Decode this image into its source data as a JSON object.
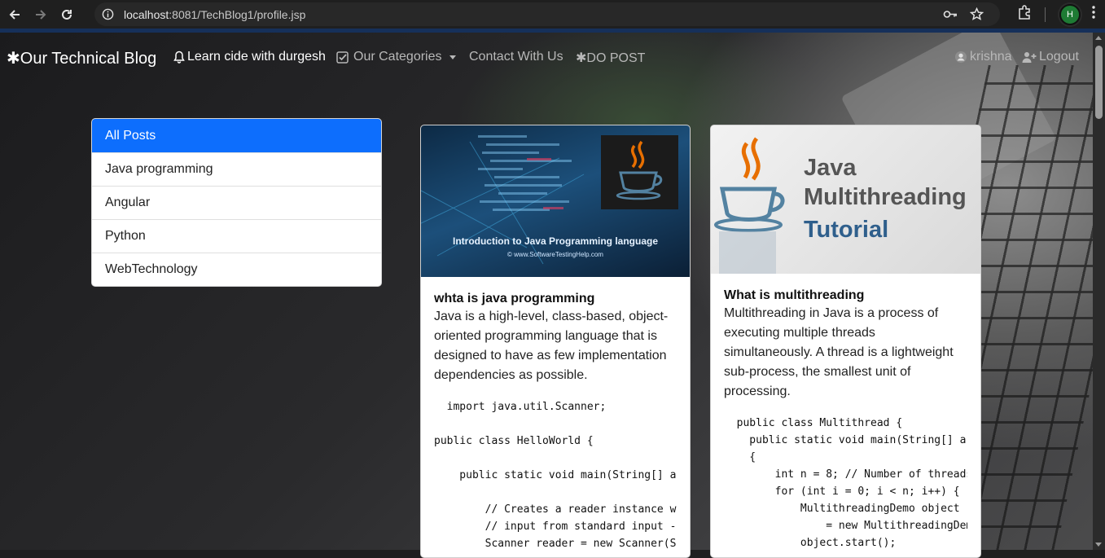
{
  "browser": {
    "url_host": "localhost",
    "url_rest": ":8081/TechBlog1/profile.jsp",
    "profile_initial": "H"
  },
  "navbar": {
    "brand": "✱Our Technical Blog",
    "learn": "Learn cide with durgesh",
    "categories": "Our Categories",
    "contact": "Contact With Us",
    "do_post": "✱DO POST",
    "user": "krishna",
    "logout": "Logout"
  },
  "categories": {
    "items": [
      "All Posts",
      "Java programming",
      "Angular",
      "Python",
      "WebTechnology"
    ]
  },
  "posts": [
    {
      "title": "whta is java programming",
      "image_caption": "Introduction to Java Programming language",
      "image_sub": "© www.SoftwareTestingHelp.com",
      "content": "Java is a high-level, class-based, object-oriented programming language that is designed to have as few implementation dependencies as possible.",
      "code": "  import java.util.Scanner;\n\npublic class HelloWorld {\n\n    public static void main(String[] ar\n\n        // Creates a reader instance wh\n        // input from standard input -\n        Scanner reader = new Scanner(Sy"
    },
    {
      "title": "What is multithreading",
      "image_line1": "Java",
      "image_line2": "Multithreading",
      "image_line3": "Tutorial",
      "content": "Multithreading in Java is a process of executing multiple threads simultaneously. A thread is a lightweight sub-process, the smallest unit of processing.",
      "code": "  public class Multithread {\n    public static void main(String[] ar\n    {\n        int n = 8; // Number of threads\n        for (int i = 0; i < n; i++) {\n            MultithreadingDemo object\n                = new MultithreadingDem\n            object.start();"
    }
  ],
  "colors": {
    "active_category": "#0d6efd",
    "chrome_background": "#1f1f1f",
    "accent_bar": "#16305a"
  }
}
